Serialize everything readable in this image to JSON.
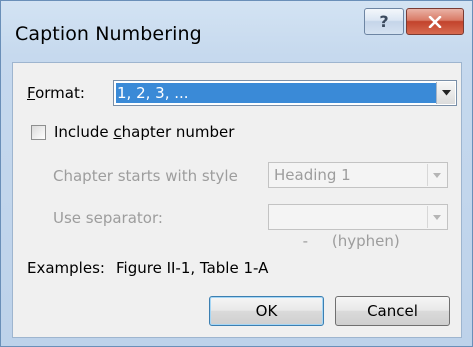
{
  "window": {
    "title": "Caption Numbering",
    "help_symbol": "?",
    "close_symbol": "X"
  },
  "format": {
    "label_underlined": "F",
    "label_rest": "ormat:",
    "value": "1, 2, 3, ..."
  },
  "include_chapter": {
    "checked": false,
    "label_before": "Include ",
    "label_underlined": "c",
    "label_after": "hapter number"
  },
  "chapter_style": {
    "label": "Chapter starts with style",
    "value": "Heading 1"
  },
  "separator": {
    "label": "Use separator:",
    "value": "-     (hyphen)"
  },
  "examples": {
    "label": "Examples:",
    "value": "Figure II-1, Table 1-A"
  },
  "buttons": {
    "ok": "OK",
    "cancel": "Cancel"
  },
  "colors": {
    "selection": "#3a8ad7",
    "title_bar": "#c6d9ee",
    "close_button": "#c2432c",
    "disabled_text": "#9d9d9d"
  }
}
